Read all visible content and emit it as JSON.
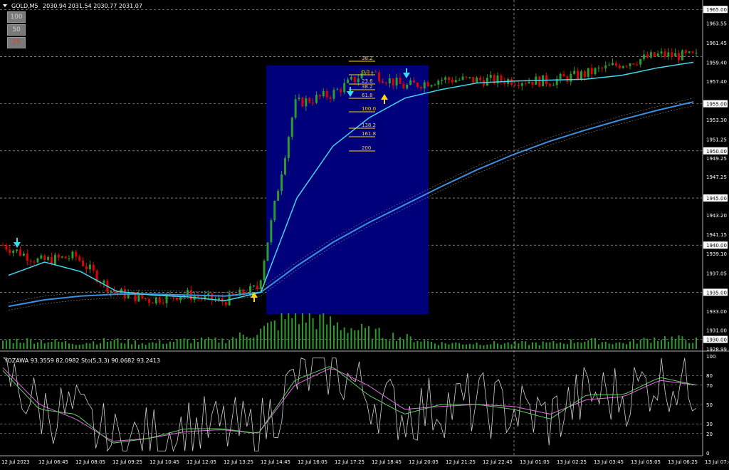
{
  "header": {
    "symbol": "GOLD,M5",
    "prices": "2030.94 2031.54 2030.77 2031.07"
  },
  "buttons": [
    "100",
    "50",
    "25"
  ],
  "indicator": {
    "label": "YOZAWA 93.3559 82.0982  Sto(5,3,3) 90.0682 93.2413",
    "ticks": [
      "100",
      "80",
      "70",
      "50",
      "30",
      "20",
      "0"
    ]
  },
  "price_axis": {
    "labels": [
      "1965.00",
      "1963.55",
      "1961.45",
      "1959.40",
      "1957.40",
      "1955.00",
      "1953.30",
      "1951.25",
      "1950.00",
      "1949.25",
      "1947.25",
      "1945.00",
      "1943.20",
      "1941.15",
      "1940.00",
      "1939.10",
      "1937.05",
      "1935.00",
      "1933.00",
      "1931.00",
      "1930.00",
      "1928.99"
    ],
    "marked": [
      "1965.00",
      "1960.00",
      "1955.00",
      "1950.00",
      "1945.00",
      "1940.00",
      "1935.00",
      "1930.00"
    ]
  },
  "time_axis": [
    "12 Jul 2023",
    "12 Jul 06:45",
    "12 Jul 08:05",
    "12 Jul 09:25",
    "12 Jul 10:45",
    "12 Jul 12:05",
    "12 Jul 13:25",
    "12 Jul 14:45",
    "12 Jul 16:05",
    "12 Jul 17:25",
    "12 Jul 18:45",
    "12 Jul 20:05",
    "12 Jul 21:25",
    "12 Jul 22:45",
    "13 Jul 01:05",
    "13 Jul 02:25",
    "13 Jul 03:45",
    "13 Jul 05:05",
    "13 Jul 06:25",
    "13 Jul 07:45"
  ],
  "fibonacci": [
    "38.2",
    "0.0",
    "23.6",
    "38.2",
    "61.8",
    "100.0",
    "138.2",
    "161.8",
    "200"
  ],
  "colors": {
    "bull": "#2e9b2e",
    "bear": "#e00000",
    "fast_ma": "#40d8f0",
    "slow_ma": "#3a8fe0",
    "box": "#00007a",
    "fib": "#ffd700",
    "stoch_main": "#66cc66",
    "stoch_signal": "#e070e0",
    "yozawa": "#d0d0d0"
  },
  "chart_data": {
    "type": "candlestick",
    "symbol": "GOLD",
    "timeframe": "M5",
    "ylim": [
      1928.99,
      1966.0
    ],
    "grid": true,
    "key_points": [
      {
        "time": "12 Jul 2023",
        "price": 1940.0
      },
      {
        "time": "12 Jul 06:45",
        "price": 1938.3
      },
      {
        "time": "12 Jul 08:05",
        "price": 1938.8
      },
      {
        "time": "12 Jul 09:25",
        "price": 1935.1
      },
      {
        "time": "12 Jul 10:45",
        "price": 1934.2
      },
      {
        "time": "12 Jul 12:05",
        "price": 1934.8
      },
      {
        "time": "12 Jul 13:25",
        "price": 1934.0
      },
      {
        "time": "12 Jul 14:45",
        "price": 1935.5
      },
      {
        "time": "12 Jul 16:05",
        "price": 1955.0
      },
      {
        "time": "12 Jul 17:25",
        "price": 1956.0
      },
      {
        "time": "12 Jul 18:45",
        "price": 1958.5
      },
      {
        "time": "12 Jul 20:05",
        "price": 1956.8
      },
      {
        "time": "12 Jul 21:25",
        "price": 1957.6
      },
      {
        "time": "12 Jul 22:45",
        "price": 1957.5
      },
      {
        "time": "13 Jul 01:05",
        "price": 1957.5
      },
      {
        "time": "13 Jul 02:25",
        "price": 1957.4
      },
      {
        "time": "13 Jul 03:45",
        "price": 1958.2
      },
      {
        "time": "13 Jul 05:05",
        "price": 1959.3
      },
      {
        "time": "13 Jul 06:25",
        "price": 1960.2
      },
      {
        "time": "13 Jul 07:45",
        "price": 1960.0
      }
    ],
    "fast_ma": [
      1936.8,
      1938.2,
      1937.2,
      1935.1,
      1934.7,
      1934.5,
      1934.1,
      1935.0,
      1945.0,
      1950.5,
      1953.5,
      1955.6,
      1956.5,
      1957.2,
      1957.4,
      1957.5,
      1957.6,
      1958.0,
      1958.8,
      1959.4
    ],
    "slow_ma": [
      1933.5,
      1934.2,
      1934.6,
      1934.8,
      1934.8,
      1934.7,
      1934.6,
      1935.0,
      1937.8,
      1940.3,
      1942.4,
      1944.3,
      1946.2,
      1948.0,
      1949.6,
      1951.0,
      1952.2,
      1953.3,
      1954.3,
      1955.2
    ],
    "fib_anchor": {
      "high": 1959.7,
      "low": 1953.8
    },
    "volume": [
      3,
      3,
      2,
      3,
      2,
      3,
      3,
      6,
      12,
      9,
      6,
      4,
      2,
      2,
      2,
      2,
      3,
      2,
      4,
      3
    ],
    "stochastic_main": [
      85,
      45,
      40,
      10,
      15,
      25,
      25,
      20,
      75,
      90,
      60,
      40,
      50,
      50,
      45,
      35,
      60,
      60,
      78,
      70
    ],
    "stochastic_signal": [
      88,
      50,
      35,
      12,
      15,
      22,
      24,
      20,
      70,
      88,
      70,
      45,
      48,
      50,
      48,
      40,
      55,
      58,
      75,
      70
    ]
  }
}
